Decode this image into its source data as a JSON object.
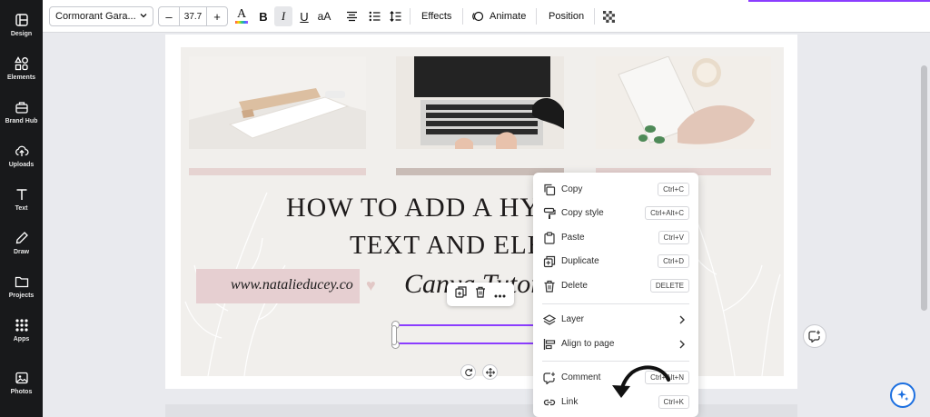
{
  "sidebar": {
    "items": [
      {
        "label": "Design",
        "icon": "design-icon"
      },
      {
        "label": "Elements",
        "icon": "elements-icon"
      },
      {
        "label": "Brand Hub",
        "icon": "brand-hub-icon"
      },
      {
        "label": "Uploads",
        "icon": "upload-cloud-icon"
      },
      {
        "label": "Text",
        "icon": "text-t-icon"
      },
      {
        "label": "Draw",
        "icon": "draw-pen-icon"
      },
      {
        "label": "Projects",
        "icon": "folder-icon"
      },
      {
        "label": "Apps",
        "icon": "apps-grid-icon"
      },
      {
        "label": "Photos",
        "icon": "photo-icon"
      }
    ]
  },
  "toolbar": {
    "font_name": "Cormorant Gara...",
    "font_size": "37.7",
    "decrease": "–",
    "increase": "+",
    "text_color_glyph": "A",
    "bold": "B",
    "italic": "I",
    "underline": "U",
    "case": "aA",
    "effects": "Effects",
    "animate": "Animate",
    "position": "Position"
  },
  "design": {
    "title_line1": "HOW TO ADD A HYP",
    "title_line2": "TEXT AND ELEM",
    "title_line3": "Canva Tutor",
    "heart": "♥",
    "url": "www.natalieducey.co"
  },
  "context_menu": {
    "items": [
      {
        "label": "Copy",
        "shortcut": "Ctrl+C"
      },
      {
        "label": "Copy style",
        "shortcut": "Ctrl+Alt+C"
      },
      {
        "label": "Paste",
        "shortcut": "Ctrl+V"
      },
      {
        "label": "Duplicate",
        "shortcut": "Ctrl+D"
      },
      {
        "label": "Delete",
        "shortcut": "DELETE"
      },
      {
        "label": "Layer",
        "shortcut": ""
      },
      {
        "label": "Align to page",
        "shortcut": ""
      },
      {
        "label": "Comment",
        "shortcut": "Ctrl+Alt+N"
      },
      {
        "label": "Link",
        "shortcut": "Ctrl+K"
      }
    ]
  },
  "colors": {
    "accent": "#8b3dff",
    "sidebar_bg": "#18191b",
    "design_bg": "#f1efec",
    "pink_bar": "#e6d3d1",
    "gray_bar": "#c9bcb6"
  }
}
